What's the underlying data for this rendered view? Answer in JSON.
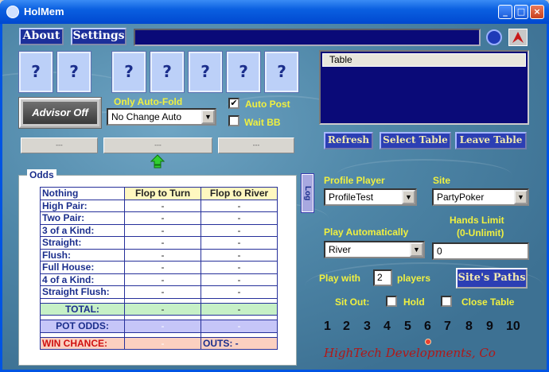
{
  "window": {
    "title": "HolMem"
  },
  "nav": {
    "about": "About",
    "settings": "Settings"
  },
  "cards": [
    "?",
    "?",
    "?",
    "?",
    "?",
    "?",
    "?"
  ],
  "table_list": {
    "header": "Table"
  },
  "advisor": {
    "label": "Advisor Off"
  },
  "auto_fold": {
    "label": "Only Auto-Fold",
    "value": "No Change Auto"
  },
  "auto_post": {
    "label": "Auto Post",
    "checked": true
  },
  "wait_bb": {
    "label": "Wait BB",
    "checked": false
  },
  "blank_buttons": [
    "---",
    "---",
    "---"
  ],
  "table_actions": {
    "refresh": "Refresh",
    "select": "Select Table",
    "leave": "Leave Table"
  },
  "log_tab": "Log",
  "odds": {
    "title": "Odds",
    "headers": {
      "hand": "Nothing",
      "turn": "Flop to Turn",
      "river": "Flop to River"
    },
    "rows": [
      {
        "hand": "High Pair:",
        "turn": "-",
        "river": "-"
      },
      {
        "hand": "Two Pair:",
        "turn": "-",
        "river": "-"
      },
      {
        "hand": "3 of a Kind:",
        "turn": "-",
        "river": "-"
      },
      {
        "hand": "Straight:",
        "turn": "-",
        "river": "-"
      },
      {
        "hand": "Flush:",
        "turn": "-",
        "river": "-"
      },
      {
        "hand": "Full House:",
        "turn": "-",
        "river": "-"
      },
      {
        "hand": "4 of a Kind:",
        "turn": "-",
        "river": "-"
      },
      {
        "hand": "Straight Flush:",
        "turn": "-",
        "river": "-"
      }
    ],
    "total": {
      "label": "TOTAL:",
      "turn": "-",
      "river": "-"
    },
    "pot_odds": {
      "label": "POT ODDS:",
      "turn": "-",
      "river": "-"
    },
    "win_chance": {
      "label": "WIN CHANCE:",
      "turn": "-",
      "outs": "OUTS: -"
    }
  },
  "profile": {
    "label": "Profile Player",
    "value": "ProfileTest"
  },
  "site": {
    "label": "Site",
    "value": "PartyPoker"
  },
  "hands_limit": {
    "label1": "Hands Limit",
    "label2": "(0-Unlimit)",
    "value": "0"
  },
  "play_auto": {
    "label": "Play Automatically",
    "value": "River"
  },
  "play_with": {
    "label": "Play with",
    "value": "2",
    "suffix": "players"
  },
  "sites_paths": "Site's Paths",
  "sit_out": {
    "label": "Sit Out:",
    "hold": "Hold",
    "close": "Close Table"
  },
  "seat_numbers": [
    "1",
    "2",
    "3",
    "4",
    "5",
    "6",
    "7",
    "8",
    "9",
    "10"
  ],
  "footer": "HighTech Developments, Co",
  "colors": {
    "titlebar": "#0a5fe0",
    "nav_button": "#1c2f9a",
    "accent_yellow": "#f0f040",
    "footer_red": "#b01818"
  }
}
